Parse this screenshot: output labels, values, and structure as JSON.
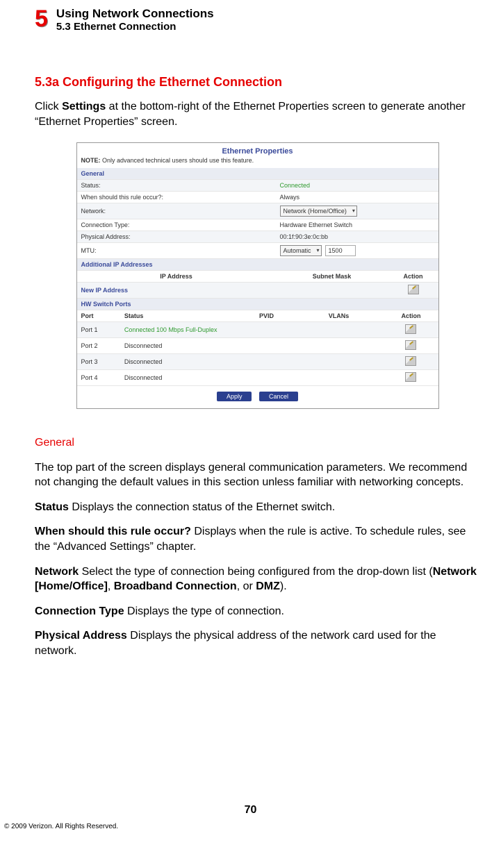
{
  "header": {
    "chapter_number": "5",
    "chapter_title": "Using Network Connections",
    "section_title": "5.3  Ethernet Connection"
  },
  "section_head": "5.3a  Configuring the Ethernet Connection",
  "intro_pre": "Click ",
  "intro_bold": "Settings",
  "intro_post": " at the bottom-right of the Ethernet Properties screen to generate another “Ethernet Properties” screen.",
  "figure": {
    "title": "Ethernet Properties",
    "note_label": "NOTE:",
    "note_text": " Only advanced technical users should use this feature.",
    "general_label": "General",
    "rows": {
      "status_label": "Status:",
      "status_value": "Connected",
      "rule_label": "When should this rule occur?:",
      "rule_value": "Always",
      "network_label": "Network:",
      "network_value": "Network (Home/Office)",
      "conntype_label": "Connection Type:",
      "conntype_value": "Hardware Ethernet Switch",
      "phys_label": "Physical Address:",
      "phys_value": "00:1f:90:3e:0c:bb",
      "mtu_label": "MTU:",
      "mtu_mode": "Automatic",
      "mtu_value": "1500"
    },
    "addl_ip_label": "Additional IP Addresses",
    "ip_headers": {
      "ip": "IP Address",
      "mask": "Subnet Mask",
      "action": "Action"
    },
    "new_ip_label": "New IP Address",
    "hw_label": "HW Switch Ports",
    "port_headers": {
      "port": "Port",
      "status": "Status",
      "pvid": "PVID",
      "vlans": "VLANs",
      "action": "Action"
    },
    "ports": [
      {
        "name": "Port 1",
        "status": "Connected 100 Mbps Full-Duplex",
        "connected": true
      },
      {
        "name": "Port 2",
        "status": "Disconnected",
        "connected": false
      },
      {
        "name": "Port 3",
        "status": "Disconnected",
        "connected": false
      },
      {
        "name": "Port 4",
        "status": "Disconnected",
        "connected": false
      }
    ],
    "apply": "Apply",
    "cancel": "Cancel"
  },
  "general_heading": "General",
  "general_intro": "The top part of the screen displays general communication parameters. We recommend not changing the default values in this section unless familiar with networking concepts.",
  "defs": {
    "status_term": "Status",
    "status_text": "  Displays the connection status of the Ethernet switch.",
    "rule_term": "When should this rule occur?",
    "rule_text": "  Displays when the rule is active. To schedule rules, see the “Advanced Settings” chapter.",
    "network_term": "Network",
    "network_pre": "  Select the type of connection being configured from the drop-down list (",
    "network_b1": "Network [Home/Office]",
    "network_mid1": ", ",
    "network_b2": "Broadband Connection",
    "network_mid2": ", or ",
    "network_b3": "DMZ",
    "network_post": ").",
    "conntype_term": "Connection Type",
    "conntype_text": "  Displays the type of connection.",
    "phys_term": "Physical Address",
    "phys_text": "  Displays the physical address of the network card used for the network."
  },
  "page_number": "70",
  "copyright": "© 2009 Verizon. All Rights Reserved."
}
